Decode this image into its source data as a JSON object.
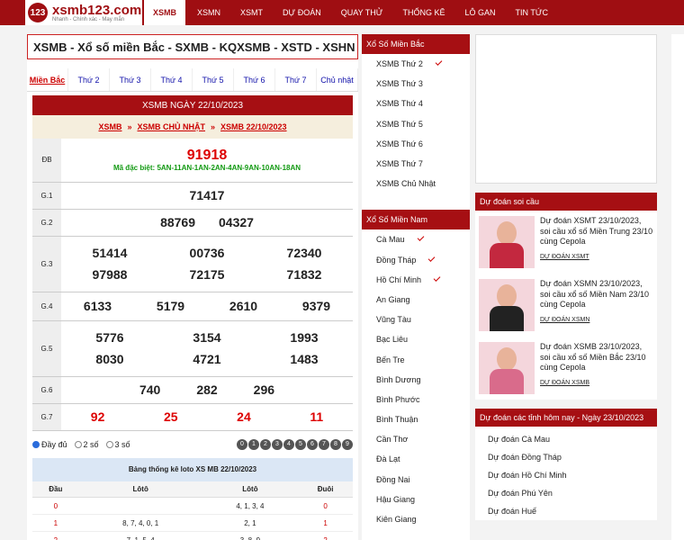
{
  "logo": {
    "brand": "xsmb123.com",
    "tagline": "Nhanh - Chính xác - May mắn"
  },
  "nav": [
    "XSMB",
    "XSMN",
    "XSMT",
    "DỰ ĐOÁN",
    "QUAY THỬ",
    "THỐNG KÊ",
    "LÔ GAN",
    "TIN TỨC"
  ],
  "page_title": "XSMB - Xổ số miền Bắc - SXMB - KQXSMB - XSTD - XSHN",
  "day_tabs": [
    "Miền Bắc",
    "Thứ 2",
    "Thứ 3",
    "Thứ 4",
    "Thứ 5",
    "Thứ 6",
    "Thứ 7",
    "Chủ nhật"
  ],
  "result_header": "XSMB NGÀY 22/10/2023",
  "breadcrumb": [
    "XSMB",
    "XSMB CHỦ NHẬT",
    "XSMB 22/10/2023"
  ],
  "results": {
    "db_label": "ĐB",
    "db": "91918",
    "ma_db_label": "Mã đặc biệt:",
    "ma_db": "5AN-11AN-1AN-2AN-4AN-9AN-10AN-18AN",
    "g1_label": "G.1",
    "g1": [
      "71417"
    ],
    "g2_label": "G.2",
    "g2": [
      "88769",
      "04327"
    ],
    "g3_label": "G.3",
    "g3": [
      "51414",
      "00736",
      "72340",
      "97988",
      "72175",
      "71832"
    ],
    "g4_label": "G.4",
    "g4": [
      "6133",
      "5179",
      "2610",
      "9379"
    ],
    "g5_label": "G.5",
    "g5": [
      "5776",
      "3154",
      "1993",
      "8030",
      "4721",
      "1483"
    ],
    "g6_label": "G.6",
    "g6": [
      "740",
      "282",
      "296"
    ],
    "g7_label": "G.7",
    "g7": [
      "92",
      "25",
      "24",
      "11"
    ]
  },
  "options": [
    "Đầy đủ",
    "2 số",
    "3 số"
  ],
  "digits": [
    "0",
    "1",
    "2",
    "3",
    "4",
    "5",
    "6",
    "7",
    "8",
    "9"
  ],
  "stats_title": "Bảng thống kê loto XS MB 22/10/2023",
  "stats_headers": [
    "Đầu",
    "Lôtô",
    "Lôtô",
    "Đuôi"
  ],
  "stats_rows": [
    [
      "0",
      "",
      "4, 1, 3, 4",
      "0"
    ],
    [
      "1",
      "8, 7, 4, 0, 1",
      "2, 1",
      "1"
    ],
    [
      "2",
      "7, 1, 5, 4",
      "3, 8, 9",
      "2"
    ]
  ],
  "mien_bac_head": "Xổ Số Miền Bắc",
  "mien_bac": [
    "XSMB Thứ 2",
    "XSMB Thứ 3",
    "XSMB Thứ 4",
    "XSMB Thứ 5",
    "XSMB Thứ 6",
    "XSMB Thứ 7",
    "XSMB Chủ Nhật"
  ],
  "mien_nam_head": "Xổ Số Miền Nam",
  "mien_nam": [
    "Cà Mau",
    "Đồng Tháp",
    "Hồ Chí Minh",
    "An Giang",
    "Vũng Tàu",
    "Bạc Liêu",
    "Bến Tre",
    "Bình Dương",
    "Bình Phước",
    "Bình Thuận",
    "Cần Thơ",
    "Đà Lạt",
    "Đồng Nai",
    "Hậu Giang",
    "Kiên Giang"
  ],
  "du_doan_head": "Dự đoán soi cầu",
  "posts": [
    {
      "title": "Dự đoán XSMT 23/10/2023, soi cầu xổ số Miền Trung 23/10 cùng Cepola",
      "tag": "DỰ ĐOÁN XSMT"
    },
    {
      "title": "Dự đoán XSMN 23/10/2023, soi cầu xổ số Miền Nam 23/10 cùng Cepola",
      "tag": "DỰ ĐOÁN XSMN"
    },
    {
      "title": "Dự đoán XSMB 23/10/2023, soi cầu xổ số Miền Bắc 23/10 cùng Cepola",
      "tag": "DỰ ĐOÁN XSMB"
    }
  ],
  "tinh_head": "Dự đoán các tỉnh hôm nay - Ngày 23/10/2023",
  "tinh": [
    "Dự đoán Cà Mau",
    "Dự đoán Đồng Tháp",
    "Dự đoán Hồ Chí Minh",
    "Dự đoán Phú Yên",
    "Dự đoán Huế"
  ]
}
